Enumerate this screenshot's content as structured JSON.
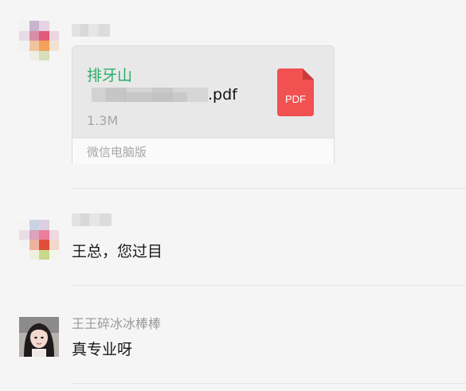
{
  "colors": {
    "background": "#f5f5f5",
    "sender_name": "#9a9a9a",
    "file_title": "#2aae67",
    "pdf_icon": "#f25151",
    "message_text": "#1a1a1a"
  },
  "messages": [
    {
      "type": "file",
      "sender_name": "",
      "avatar": "pixelated-avatar",
      "file": {
        "title": "排牙山",
        "name_suffix": ".pdf",
        "size": "1.3M",
        "icon": "pdf-file-icon",
        "icon_label": "PDF",
        "source": "微信电脑版"
      }
    },
    {
      "type": "text",
      "sender_name": "",
      "avatar": "pixelated-avatar",
      "text": "王总，您过目"
    },
    {
      "type": "text",
      "sender_name": "王王碎冰冰棒棒",
      "avatar": "photo-avatar",
      "text": "真专业呀"
    }
  ]
}
